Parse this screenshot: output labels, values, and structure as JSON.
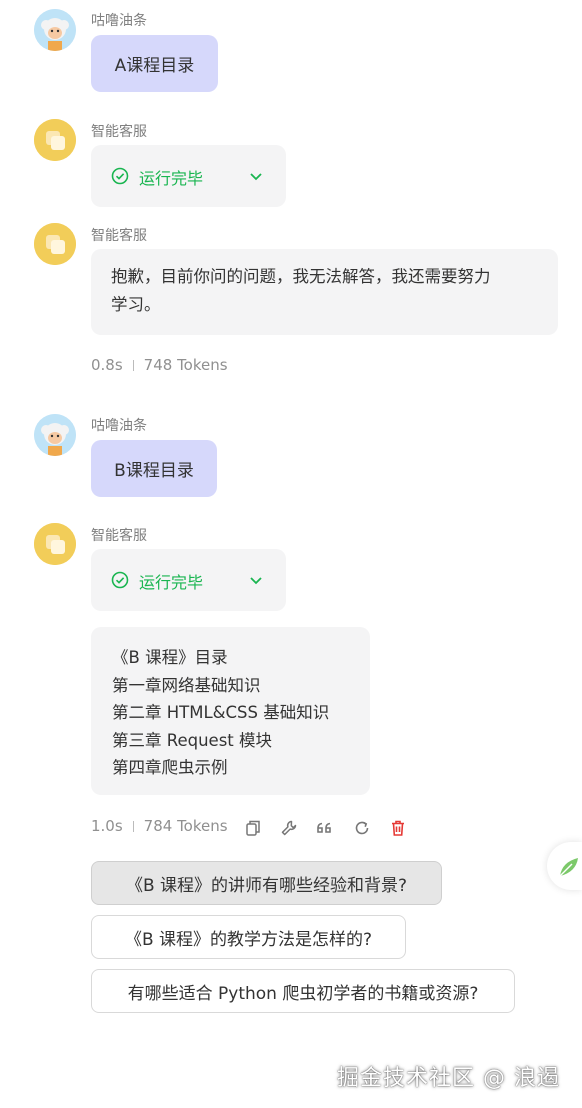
{
  "messages": [
    {
      "role": "user",
      "name": "咕噜油条",
      "text": "A课程目录"
    },
    {
      "role": "bot",
      "name": "智能客服",
      "status": "运行完毕"
    },
    {
      "role": "bot",
      "name": "智能客服",
      "answer_line1": "抱歉，目前你问的问题，我无法解答，我还需要努力",
      "answer_line2": "学习。",
      "time": "0.8s",
      "tokens": "748 Tokens"
    },
    {
      "role": "user",
      "name": "咕噜油条",
      "text": "B课程目录"
    },
    {
      "role": "bot",
      "name": "智能客服",
      "status": "运行完毕",
      "answer_lines": [
        "《B 课程》目录",
        "第一章网络基础知识",
        "第二章 HTML&CSS 基础知识",
        "第三章 Request 模块",
        "第四章爬虫示例"
      ],
      "time": "1.0s",
      "tokens": "784 Tokens"
    }
  ],
  "toolbar_icons": [
    "copy-icon",
    "wrench-icon",
    "quote-icon",
    "refresh-icon",
    "delete-icon"
  ],
  "suggestions": [
    "《B 课程》的讲师有哪些经验和背景?",
    "《B 课程》的教学方法是怎样的?",
    "有哪些适合 Python 爬虫初学者的书籍或资源?"
  ],
  "watermark": "掘金技术社区 @ 浪遏",
  "colors": {
    "user_bubble": "#d6d8fb",
    "bot_bubble": "#f4f4f5",
    "success": "#19b550",
    "delete": "#e53935"
  }
}
